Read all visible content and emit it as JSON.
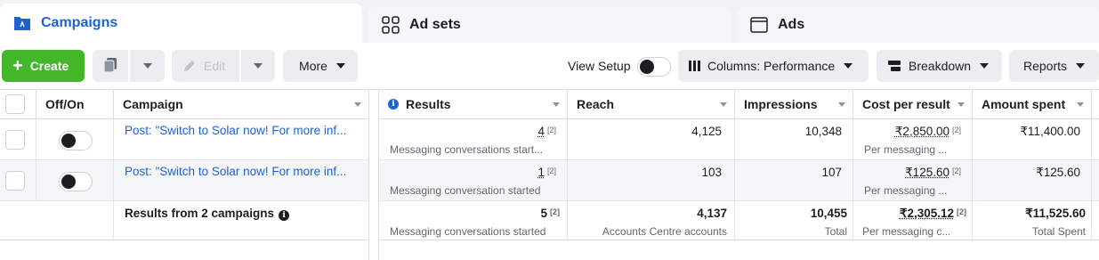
{
  "tabs": [
    {
      "label": "Campaigns",
      "icon": "folder-icon",
      "active": true
    },
    {
      "label": "Ad sets",
      "icon": "grid-icon",
      "active": false
    },
    {
      "label": "Ads",
      "icon": "ad-window-icon",
      "active": false
    }
  ],
  "toolbar": {
    "create_label": "Create",
    "edit_label": "Edit",
    "more_label": "More",
    "view_setup_label": "View Setup",
    "columns_label": "Columns: Performance",
    "breakdown_label": "Breakdown",
    "reports_label": "Reports"
  },
  "colors": {
    "accent": "#1d63d1",
    "create": "#43b72a"
  },
  "table": {
    "headers": {
      "offon": "Off/On",
      "campaign": "Campaign",
      "results": "Results",
      "reach": "Reach",
      "impressions": "Impressions",
      "cost": "Cost per result",
      "spent": "Amount spent"
    },
    "rows": [
      {
        "campaign": "Post: \"Switch to Solar now! For more inf...",
        "results": "4",
        "results_sub": "Messaging conversations start...",
        "reach": "4,125",
        "impressions": "10,348",
        "cost": "₹2,850.00",
        "cost_sub": "Per messaging ...",
        "spent": "₹11,400.00",
        "note": "[2]"
      },
      {
        "campaign": "Post: \"Switch to Solar now! For more inf...",
        "results": "1",
        "results_sub": "Messaging conversation started",
        "reach": "103",
        "impressions": "107",
        "cost": "₹125.60",
        "cost_sub": "Per messaging ...",
        "spent": "₹125.60",
        "note": "[2]"
      }
    ],
    "totals": {
      "label": "Results from 2 campaigns",
      "results": "5",
      "results_sub": "Messaging conversations started",
      "reach": "4,137",
      "reach_sub": "Accounts Centre accounts",
      "impressions": "10,455",
      "impressions_sub": "Total",
      "cost": "₹2,305.12",
      "cost_sub": "Per messaging c...",
      "spent": "₹11,525.60",
      "spent_sub": "Total Spent",
      "note": "[2]"
    }
  }
}
